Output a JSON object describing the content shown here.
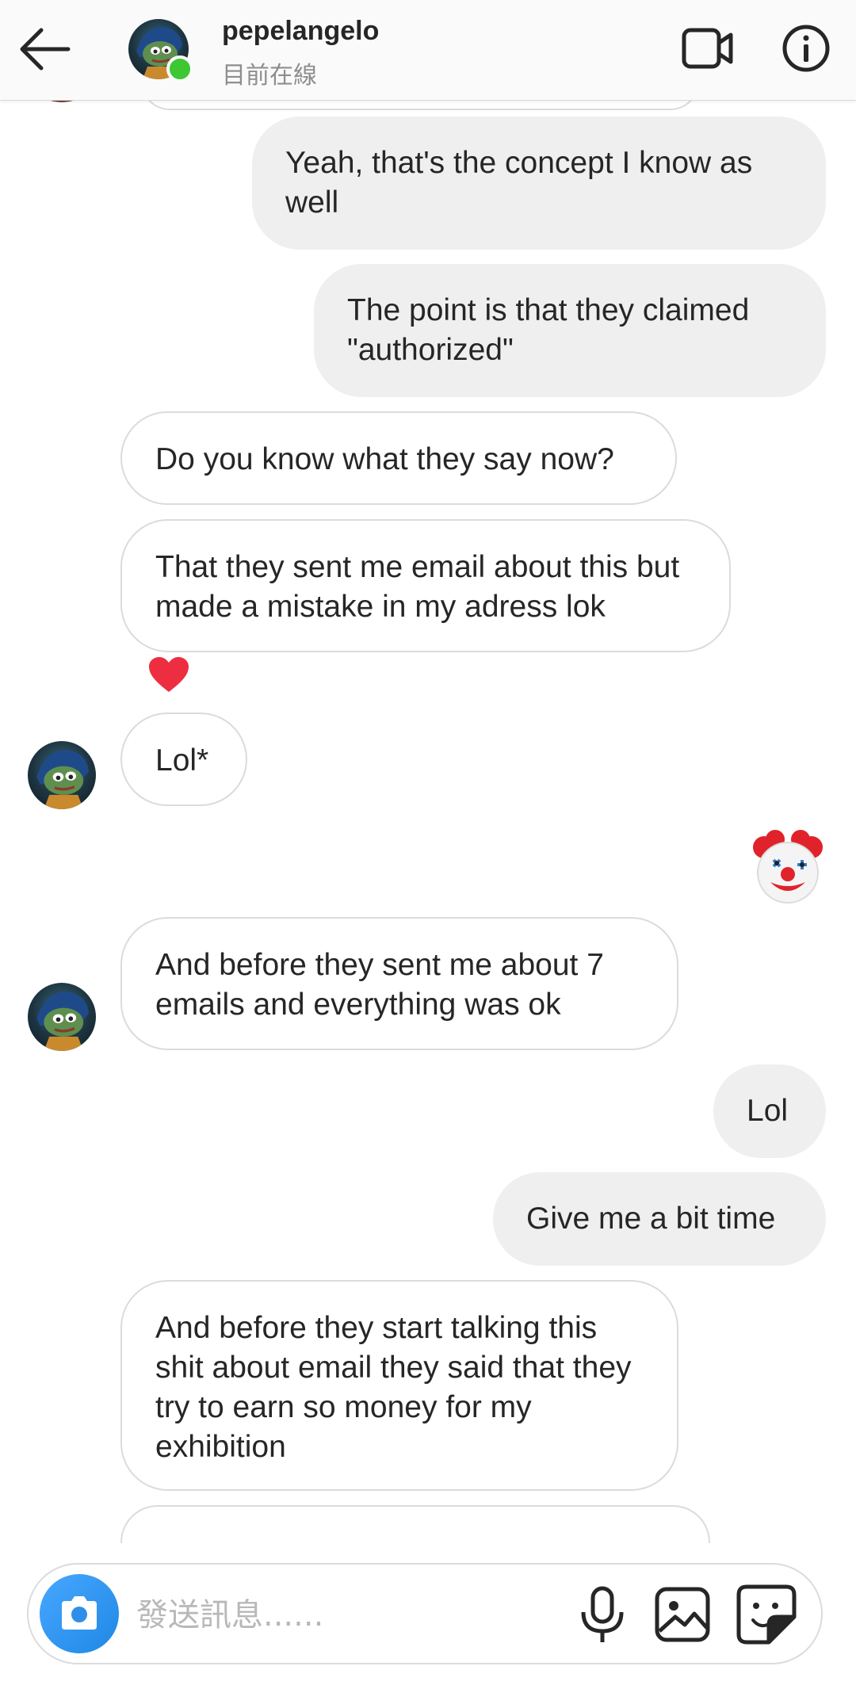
{
  "header": {
    "username": "pepelangelo",
    "status": "目前在線"
  },
  "messages": [
    {
      "id": "m1",
      "direction": "out",
      "text": "Yeah, that's the concept I know as well"
    },
    {
      "id": "m2",
      "direction": "out",
      "text": "The point is that they claimed \"authorized\""
    },
    {
      "id": "m3",
      "direction": "in",
      "text": "Do you know what they say now?"
    },
    {
      "id": "m4",
      "direction": "in",
      "text": "That they sent me email about this but made a mistake in my adress lok",
      "reaction": "heart"
    },
    {
      "id": "m5",
      "direction": "in",
      "text": "Lol*"
    },
    {
      "id": "m6",
      "direction": "out",
      "emoji": "clown-face"
    },
    {
      "id": "m7",
      "direction": "in",
      "text": "And before they sent me about 7 emails and everything was ok"
    },
    {
      "id": "m8",
      "direction": "out",
      "text": "Lol"
    },
    {
      "id": "m9",
      "direction": "out",
      "text": "Give me a bit time"
    },
    {
      "id": "m10",
      "direction": "in",
      "text": "And before they start talking this shit about email they said that they try to earn so money for my exhibition"
    }
  ],
  "composer": {
    "placeholder": "發送訊息......"
  },
  "colors": {
    "online": "#3cc733",
    "reaction_heart": "#ed2e40",
    "camera_button": "#1e88e5",
    "outgoing_bubble": "#efefef",
    "incoming_border": "#dbdbdb"
  },
  "icons": [
    "back-arrow-icon",
    "video-call-icon",
    "info-icon",
    "camera-icon",
    "microphone-icon",
    "gallery-icon",
    "sticker-icon"
  ]
}
